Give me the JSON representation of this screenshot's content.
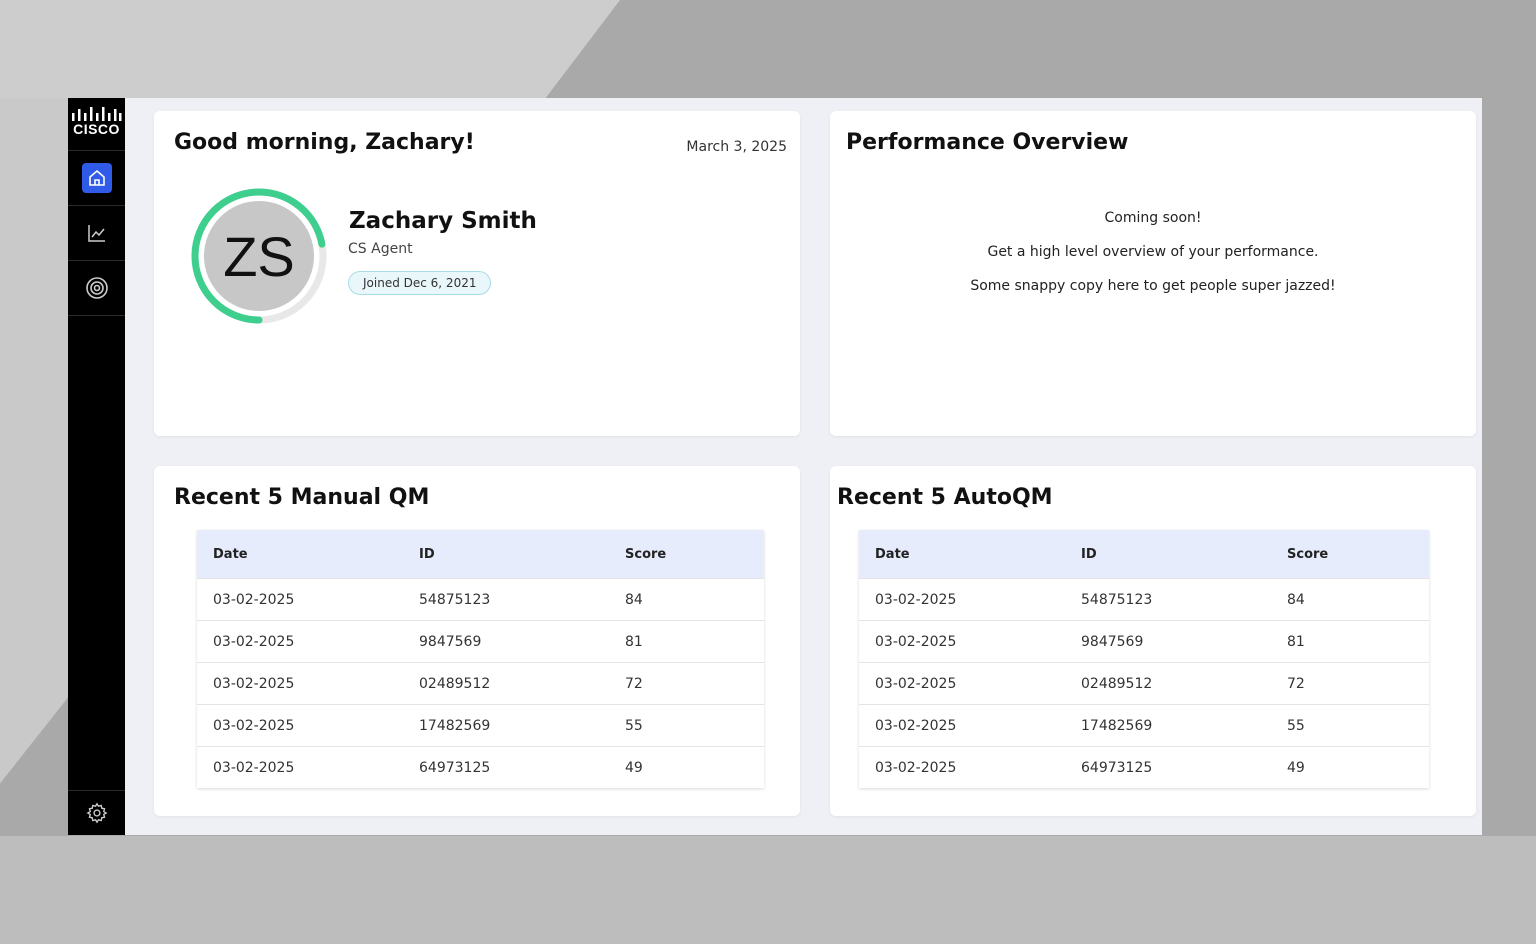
{
  "colors": {
    "accent": "#2f5be8",
    "progress_ring": "#3ecf8e",
    "table_header_bg": "#e6ecfc"
  },
  "sidebar": {
    "logo_text": "CISCO",
    "items": [
      {
        "icon": "home-icon",
        "active": true
      },
      {
        "icon": "chart-line-icon",
        "active": false
      },
      {
        "icon": "target-icon",
        "active": false
      }
    ],
    "settings_icon": "gear-icon"
  },
  "welcome": {
    "greeting": "Good morning, Zachary!",
    "date": "March 3, 2025",
    "initials": "ZS",
    "name": "Zachary Smith",
    "role": "CS Agent",
    "joined": "Joined Dec 6, 2021",
    "progress_fraction": 0.72
  },
  "performance": {
    "title": "Performance Overview",
    "lines": [
      "Coming soon!",
      "Get a high level overview of your performance.",
      "Some snappy copy here to get people super jazzed!"
    ]
  },
  "manual_qm": {
    "title": "Recent 5 Manual QM",
    "columns": [
      "Date",
      "ID",
      "Score"
    ],
    "rows": [
      [
        "03-02-2025",
        "54875123",
        "84"
      ],
      [
        "03-02-2025",
        "9847569",
        "81"
      ],
      [
        "03-02-2025",
        "02489512",
        "72"
      ],
      [
        "03-02-2025",
        "17482569",
        "55"
      ],
      [
        "03-02-2025",
        "64973125",
        "49"
      ]
    ]
  },
  "auto_qm": {
    "title": "Recent 5 AutoQM",
    "columns": [
      "Date",
      "ID",
      "Score"
    ],
    "rows": [
      [
        "03-02-2025",
        "54875123",
        "84"
      ],
      [
        "03-02-2025",
        "9847569",
        "81"
      ],
      [
        "03-02-2025",
        "02489512",
        "72"
      ],
      [
        "03-02-2025",
        "17482569",
        "55"
      ],
      [
        "03-02-2025",
        "64973125",
        "49"
      ]
    ]
  }
}
